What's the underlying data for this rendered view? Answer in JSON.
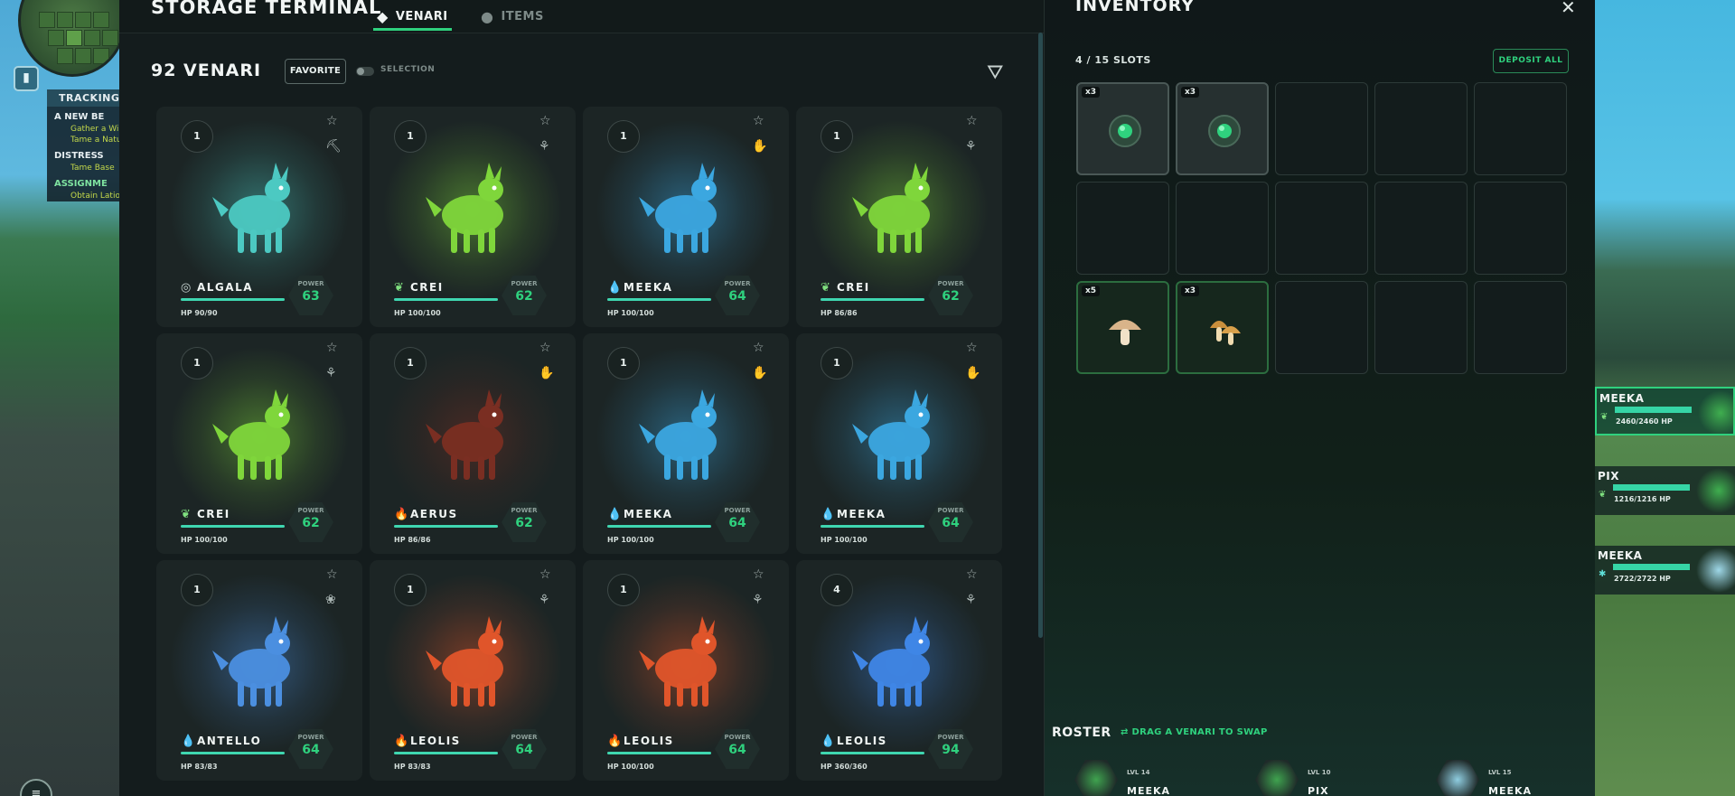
{
  "terminal": {
    "title": "STORAGE TERMINAL",
    "tabs": [
      {
        "label": "VENARI",
        "icon": "wolf-head-icon",
        "active": true
      },
      {
        "label": "ITEMS",
        "icon": "apple-icon",
        "active": false
      }
    ]
  },
  "venari_list": {
    "count_label": "92 VENARI",
    "favorite_label": "FAVORITE",
    "selection_label": "SELECTION",
    "cards": [
      {
        "level": "1",
        "name": "ALGALA",
        "element": "wind",
        "hp_label": "HP 90/90",
        "hp_frac": 1.0,
        "power_label": "POWER",
        "power": "63",
        "color": "#4cc9c2",
        "trait_icon": "pickaxe-icon"
      },
      {
        "level": "1",
        "name": "CREI",
        "element": "nature",
        "hp_label": "HP 100/100",
        "hp_frac": 1.0,
        "power_label": "POWER",
        "power": "62",
        "color": "#7fd63b",
        "trait_icon": "leaf-gather-icon"
      },
      {
        "level": "1",
        "name": "MEEKA",
        "element": "water",
        "hp_label": "HP 100/100",
        "hp_frac": 1.0,
        "power_label": "POWER",
        "power": "64",
        "color": "#3ba7e0",
        "trait_icon": "sparkle-hand-icon"
      },
      {
        "level": "1",
        "name": "CREI",
        "element": "nature",
        "hp_label": "HP 86/86",
        "hp_frac": 1.0,
        "power_label": "POWER",
        "power": "62",
        "color": "#7fd63b",
        "trait_icon": "leaf-gather-icon"
      },
      {
        "level": "1",
        "name": "CREI",
        "element": "nature",
        "hp_label": "HP 100/100",
        "hp_frac": 1.0,
        "power_label": "POWER",
        "power": "62",
        "color": "#7fd63b",
        "trait_icon": "leaf-gather-icon"
      },
      {
        "level": "1",
        "name": "AERUS",
        "element": "fire",
        "hp_label": "HP 86/86",
        "hp_frac": 1.0,
        "power_label": "POWER",
        "power": "62",
        "color": "#7a2e22",
        "trait_icon": "sparkle-hand-icon"
      },
      {
        "level": "1",
        "name": "MEEKA",
        "element": "water",
        "hp_label": "HP 100/100",
        "hp_frac": 1.0,
        "power_label": "POWER",
        "power": "64",
        "color": "#3ba7e0",
        "trait_icon": "sparkle-hand-icon"
      },
      {
        "level": "1",
        "name": "MEEKA",
        "element": "water",
        "hp_label": "HP 100/100",
        "hp_frac": 1.0,
        "power_label": "POWER",
        "power": "64",
        "color": "#3ba7e0",
        "trait_icon": "sparkle-hand-icon"
      },
      {
        "level": "1",
        "name": "ANTELLO",
        "element": "water",
        "hp_label": "HP 83/83",
        "hp_frac": 1.0,
        "power_label": "POWER",
        "power": "64",
        "color": "#4b8fe0",
        "trait_icon": "water-splash-icon"
      },
      {
        "level": "1",
        "name": "LEOLIS",
        "element": "fire",
        "hp_label": "HP 83/83",
        "hp_frac": 1.0,
        "power_label": "POWER",
        "power": "64",
        "color": "#e0552a",
        "trait_icon": "leaf-gather-icon"
      },
      {
        "level": "1",
        "name": "LEOLIS",
        "element": "fire",
        "hp_label": "HP 100/100",
        "hp_frac": 1.0,
        "power_label": "POWER",
        "power": "64",
        "color": "#e0552a",
        "trait_icon": "leaf-gather-icon"
      },
      {
        "level": "4",
        "name": "LEOLIS",
        "element": "water",
        "hp_label": "HP 360/360",
        "hp_frac": 1.0,
        "power_label": "POWER",
        "power": "94",
        "color": "#3f86e6",
        "trait_icon": "leaf-gather-icon"
      }
    ]
  },
  "inventory": {
    "title": "INVENTORY",
    "slots_label": "4 / 15 SLOTS",
    "deposit_label": "DEPOSIT ALL",
    "slots": [
      {
        "qty": "x3",
        "item": "seed-orb",
        "style": "filled"
      },
      {
        "qty": "x3",
        "item": "seed-orb",
        "style": "filled"
      },
      {
        "qty": "",
        "item": "",
        "style": "empty"
      },
      {
        "qty": "",
        "item": "",
        "style": "empty"
      },
      {
        "qty": "",
        "item": "",
        "style": "empty"
      },
      {
        "qty": "",
        "item": "",
        "style": "empty"
      },
      {
        "qty": "",
        "item": "",
        "style": "empty"
      },
      {
        "qty": "",
        "item": "",
        "style": "empty"
      },
      {
        "qty": "",
        "item": "",
        "style": "empty"
      },
      {
        "qty": "",
        "item": "",
        "style": "empty"
      },
      {
        "qty": "x5",
        "item": "mushroom",
        "style": "green"
      },
      {
        "qty": "x3",
        "item": "mushroom-cluster",
        "style": "green"
      },
      {
        "qty": "",
        "item": "",
        "style": "empty"
      },
      {
        "qty": "",
        "item": "",
        "style": "empty"
      },
      {
        "qty": "",
        "item": "",
        "style": "empty"
      }
    ]
  },
  "roster": {
    "label": "ROSTER",
    "hint": "DRAG A VENARI TO SWAP",
    "members": [
      {
        "level": "LVL 14",
        "name": "MEEKA",
        "color": "#3fa34f"
      },
      {
        "level": "LVL 10",
        "name": "PIX",
        "color": "#3fa34f"
      },
      {
        "level": "LVL 15",
        "name": "MEEKA",
        "color": "#8fcde0"
      }
    ]
  },
  "party": [
    {
      "name": "MEEKA",
      "hp": "2460/2460 HP",
      "hp_frac": 1.0,
      "element": "nature",
      "selected": true
    },
    {
      "name": "PIX",
      "hp": "1216/1216 HP",
      "hp_frac": 1.0,
      "element": "nature",
      "selected": false
    },
    {
      "name": "MEEKA",
      "hp": "2722/2722 HP",
      "hp_frac": 1.0,
      "element": "frost",
      "selected": false
    }
  ],
  "tracking": {
    "header": "TRACKING",
    "quests": [
      {
        "title": "A NEW BE",
        "steps": [
          "Gather a Wi",
          "Tame a Natu"
        ],
        "style": "white"
      },
      {
        "title": "DISTRESS",
        "steps": [
          "Tame Base"
        ],
        "style": "white"
      },
      {
        "title": "ASSIGNME",
        "steps": [
          "Obtain Latio"
        ],
        "style": "green"
      }
    ]
  },
  "colors": {
    "accent": "#2fd17e",
    "panel": "#141c1d",
    "card": "#1c2525"
  }
}
